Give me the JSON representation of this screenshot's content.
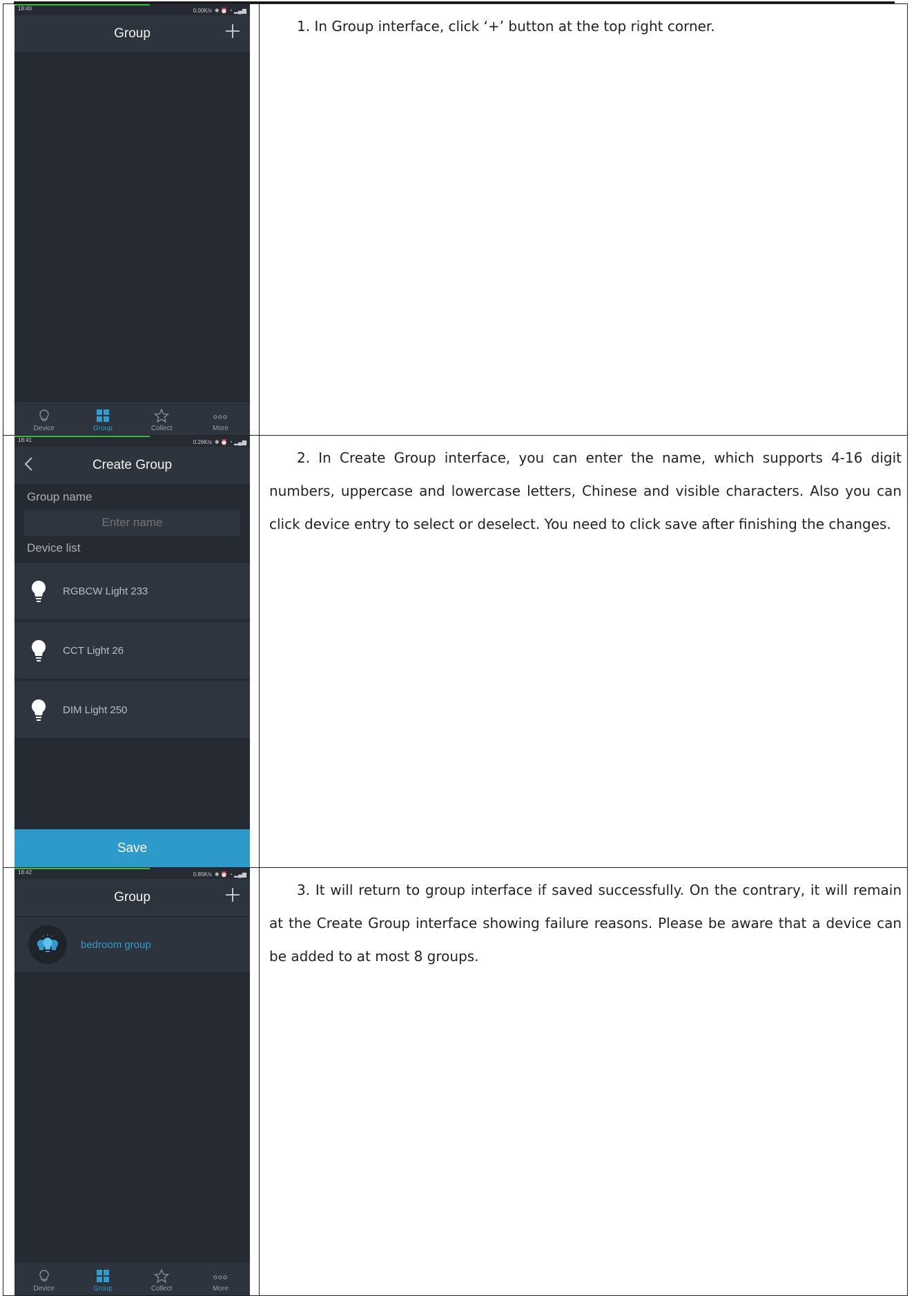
{
  "steps": [
    {
      "text": "1. In Group interface, click ‘+’ button at the top right corner.",
      "screen": {
        "time": "18:40",
        "netspeed": "0.00K/s",
        "title": "Group",
        "tabs": [
          "Device",
          "Group",
          "Collect",
          "More"
        ],
        "active_tab": "Group"
      }
    },
    {
      "text": "2. In Create Group interface, you can enter the name, which supports 4-16 digit numbers, uppercase and lowercase letters, Chinese and visible characters. Also you can click device entry to select or deselect. You need to click save after finishing the changes.",
      "screen": {
        "time": "18:41",
        "netspeed": "0.26K/s",
        "title": "Create Group",
        "group_name_label": "Group name",
        "name_placeholder": "Enter name",
        "device_list_label": "Device list",
        "devices": [
          "RGBCW Light 233",
          "CCT Light 26",
          "DIM Light 250"
        ],
        "save_label": "Save"
      }
    },
    {
      "text": "3. It will return to group interface if saved successfully. On the contrary, it will remain at the Create Group interface showing failure reasons. Please be aware that a device can be added to at most 8 groups.",
      "screen": {
        "time": "18:42",
        "netspeed": "0.85K/s",
        "title": "Group",
        "group_item": "bedroom group",
        "tabs": [
          "Device",
          "Group",
          "Collect",
          "More"
        ],
        "active_tab": "Group"
      }
    }
  ],
  "colors": {
    "accent": "#2f9bcf",
    "phone_bg": "#262b33",
    "bar_bg": "#2e343d",
    "save_bg": "#2d9bc9"
  }
}
